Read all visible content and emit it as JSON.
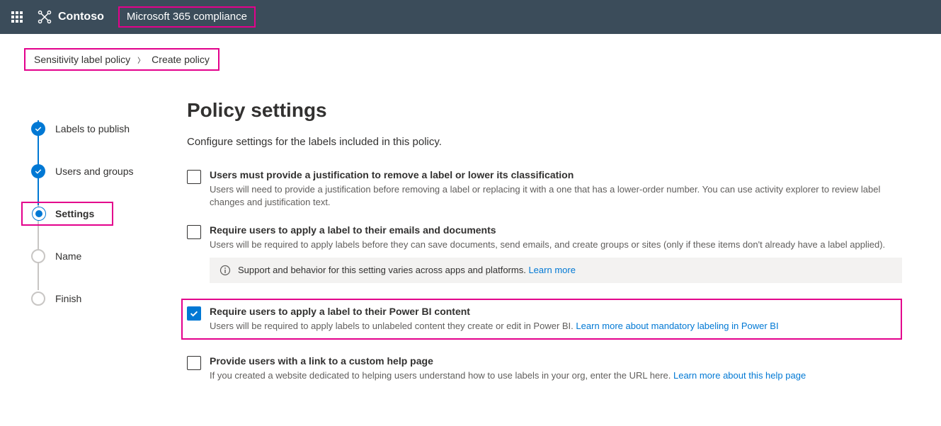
{
  "header": {
    "brand": "Contoso",
    "app_title": "Microsoft 365 compliance"
  },
  "breadcrumb": {
    "parent": "Sensitivity label policy",
    "current": "Create policy"
  },
  "stepper": {
    "steps": [
      {
        "label": "Labels to publish",
        "state": "done"
      },
      {
        "label": "Users and groups",
        "state": "done"
      },
      {
        "label": "Settings",
        "state": "current"
      },
      {
        "label": "Name",
        "state": "pending"
      },
      {
        "label": "Finish",
        "state": "pending"
      }
    ]
  },
  "content": {
    "title": "Policy settings",
    "subtitle": "Configure settings for the labels included in this policy.",
    "settings": [
      {
        "checked": false,
        "title": "Users must provide a justification to remove a label or lower its classification",
        "desc": "Users will need to provide a justification before removing a label or replacing it with a one that has a lower-order number. You can use activity explorer to review label changes and justification text."
      },
      {
        "checked": false,
        "title": "Require users to apply a label to their emails and documents",
        "desc": "Users will be required to apply labels before they can save documents, send emails, and create groups or sites (only if these items don't already have a label applied).",
        "info": "Support and behavior for this setting varies across apps and platforms.",
        "info_link": "Learn more"
      },
      {
        "checked": true,
        "title": "Require users to apply a label to their Power BI content",
        "desc": "Users will be required to apply labels to unlabeled content they create or edit in Power BI.",
        "link": "Learn more about mandatory labeling in Power BI"
      },
      {
        "checked": false,
        "title": "Provide users with a link to a custom help page",
        "desc": "If you created a website dedicated to helping users understand how to use labels in your org, enter the URL here.",
        "link": "Learn more about this help page"
      }
    ]
  }
}
